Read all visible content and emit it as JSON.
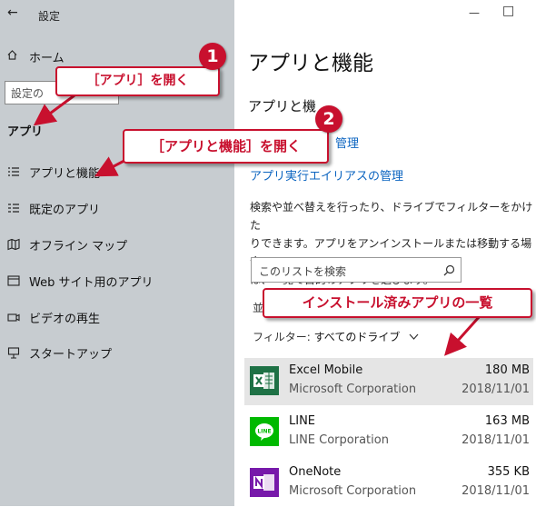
{
  "window": {
    "title": "設定",
    "back_glyph": "←",
    "minimize": "—",
    "maximize": "□"
  },
  "sidebar": {
    "home_label": "ホーム",
    "search_placeholder": "設定の",
    "section_title": "アプリ",
    "items": [
      {
        "label": "アプリと機能",
        "icon": "apps-features-icon"
      },
      {
        "label": "既定のアプリ",
        "icon": "default-apps-icon"
      },
      {
        "label": "オフライン マップ",
        "icon": "offline-maps-icon"
      },
      {
        "label": "Web サイト用のアプリ",
        "icon": "apps-for-websites-icon"
      },
      {
        "label": "ビデオの再生",
        "icon": "video-playback-icon"
      },
      {
        "label": "スタートアップ",
        "icon": "startup-icon"
      }
    ]
  },
  "main": {
    "title": "アプリと機能",
    "subtitle": "アプリと機",
    "link_manage": "管理",
    "link_alias": "アプリ実行エイリアスの管理",
    "description_lines": [
      "検索や並べ替えを行ったり、ドライブでフィルターをかけた",
      "りできます。アプリをアンインストールまたは移動する場合",
      "は、一覧で目的のアプリを選びます。"
    ],
    "list_search_placeholder": "このリストを検索",
    "sort_partial": "並",
    "filter_label": "フィルター:",
    "filter_value": "すべてのドライブ",
    "apps": [
      {
        "name": "Excel Mobile",
        "publisher": "Microsoft Corporation",
        "size": "180 MB",
        "date": "2018/11/01",
        "icon_color": "#1e7145",
        "icon_text": "X",
        "selected": true
      },
      {
        "name": "LINE",
        "publisher": "LINE Corporation",
        "size": "163 MB",
        "date": "2018/11/01",
        "icon_color": "#00b900",
        "icon_text": "LINE",
        "selected": false
      },
      {
        "name": "OneNote",
        "publisher": "Microsoft Corporation",
        "size": "355 KB",
        "date": "2018/11/01",
        "icon_color": "#7719aa",
        "icon_text": "N",
        "selected": false
      }
    ]
  },
  "annotations": {
    "step1_number": "1",
    "step1_text": "［アプリ］を開く",
    "step2_number": "2",
    "step2_text": "［アプリと機能］を開く",
    "list_text": "インストール済みアプリの一覧",
    "accent_color": "#c8102e"
  }
}
